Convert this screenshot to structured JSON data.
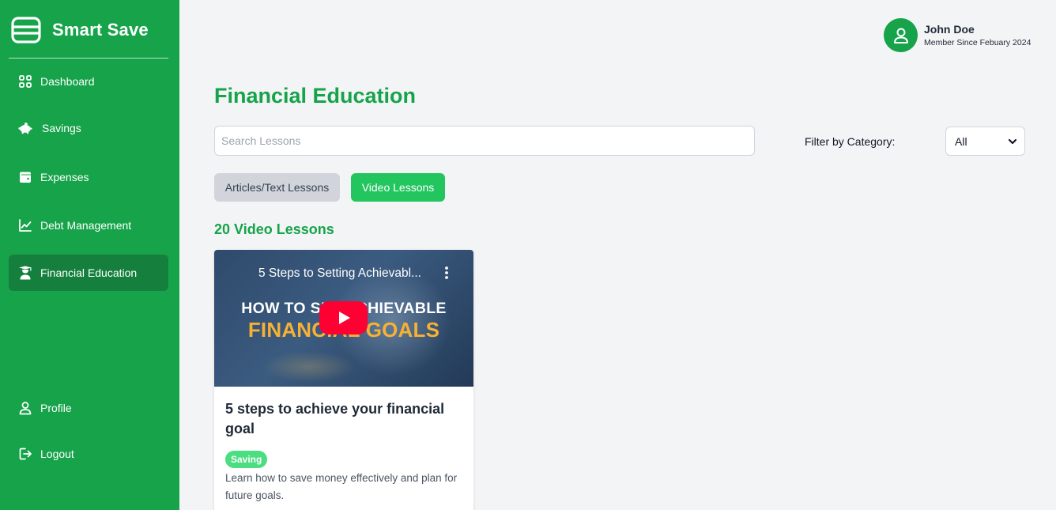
{
  "app": {
    "name": "Smart Save"
  },
  "sidebar": {
    "items": [
      {
        "label": "Dashboard",
        "icon": "grid-icon"
      },
      {
        "label": "Savings",
        "icon": "piggy-bank-icon"
      },
      {
        "label": "Expenses",
        "icon": "wallet-icon"
      },
      {
        "label": "Debt Management",
        "icon": "chart-line-icon"
      },
      {
        "label": "Financial Education",
        "icon": "graduate-icon",
        "active": true
      }
    ],
    "bottom_items": [
      {
        "label": "Profile",
        "icon": "user-icon"
      },
      {
        "label": "Logout",
        "icon": "logout-icon"
      }
    ]
  },
  "user": {
    "name": "John Doe",
    "since": "Member Since Febuary 2024"
  },
  "page": {
    "title": "Financial Education"
  },
  "search": {
    "placeholder": "Search Lessons",
    "value": ""
  },
  "filter": {
    "label": "Filter by Category:",
    "selected": "All"
  },
  "tabs": [
    {
      "label": "Articles/Text Lessons",
      "active": false
    },
    {
      "label": "Video Lessons",
      "active": true
    }
  ],
  "lessons": {
    "count_label": "20 Video Lessons",
    "items": [
      {
        "video_title": "5 Steps to Setting Achievabl...",
        "thumbnail_line1": "HOW TO SET ACHIEVABLE",
        "thumbnail_line2": "FINANCIAL GOALS",
        "title": "5 steps to achieve your financial goal",
        "category": "Saving",
        "description": "Learn how to save money effectively and plan for future goals."
      }
    ]
  },
  "colors": {
    "primary": "#16a34a",
    "primary_dark": "#15803d",
    "tab_active": "#22c55e",
    "tab_inactive": "#d1d5db",
    "tag": "#4ade80",
    "play": "#ff0033",
    "thumbnail_accent": "#f6b135"
  }
}
